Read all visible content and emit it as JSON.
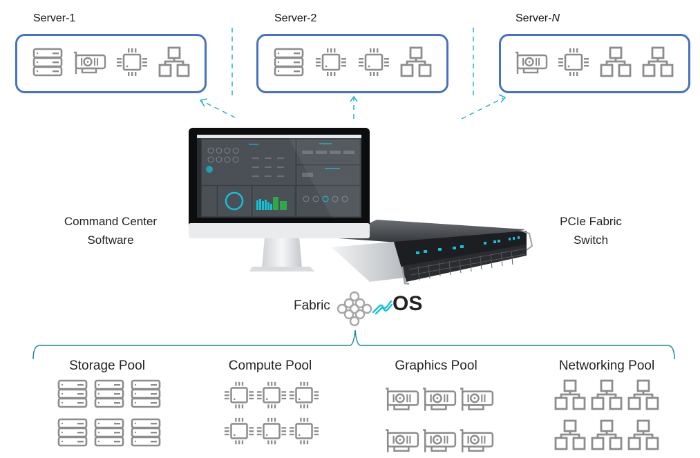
{
  "servers": [
    {
      "label_prefix": "Server-",
      "label_suffix": "1",
      "suffix_italic": false,
      "components": [
        "storage-icon",
        "gpu-icon",
        "cpu-icon",
        "network-icon"
      ]
    },
    {
      "label_prefix": "Server-",
      "label_suffix": "2",
      "suffix_italic": false,
      "components": [
        "storage-icon",
        "cpu-icon",
        "cpu-icon",
        "network-icon"
      ]
    },
    {
      "label_prefix": "Server-",
      "label_suffix": "N",
      "suffix_italic": true,
      "components": [
        "gpu-icon",
        "cpu-icon",
        "network-icon",
        "network-icon"
      ]
    }
  ],
  "command_center": {
    "line1": "Command Center",
    "line2": "Software"
  },
  "fabric_switch": {
    "line1": "PCIe Fabric",
    "line2": "Switch"
  },
  "fabric_os": {
    "prefix": "Fabric",
    "suffix": "OS"
  },
  "pools": [
    {
      "title": "Storage Pool",
      "icon": "storage-icon",
      "count": 6
    },
    {
      "title": "Compute Pool",
      "icon": "cpu-icon",
      "count": 6
    },
    {
      "title": "Graphics Pool",
      "icon": "gpu-icon",
      "count": 6
    },
    {
      "title": "Networking Pool",
      "icon": "network-icon",
      "count": 6
    }
  ],
  "colors": {
    "server_border": "#4472c4",
    "arrow": "#1fb4cf",
    "bracket": "#1a8a9a",
    "icon_gray": "#8c8c8c",
    "accent_cyan": "#12c2d6"
  }
}
